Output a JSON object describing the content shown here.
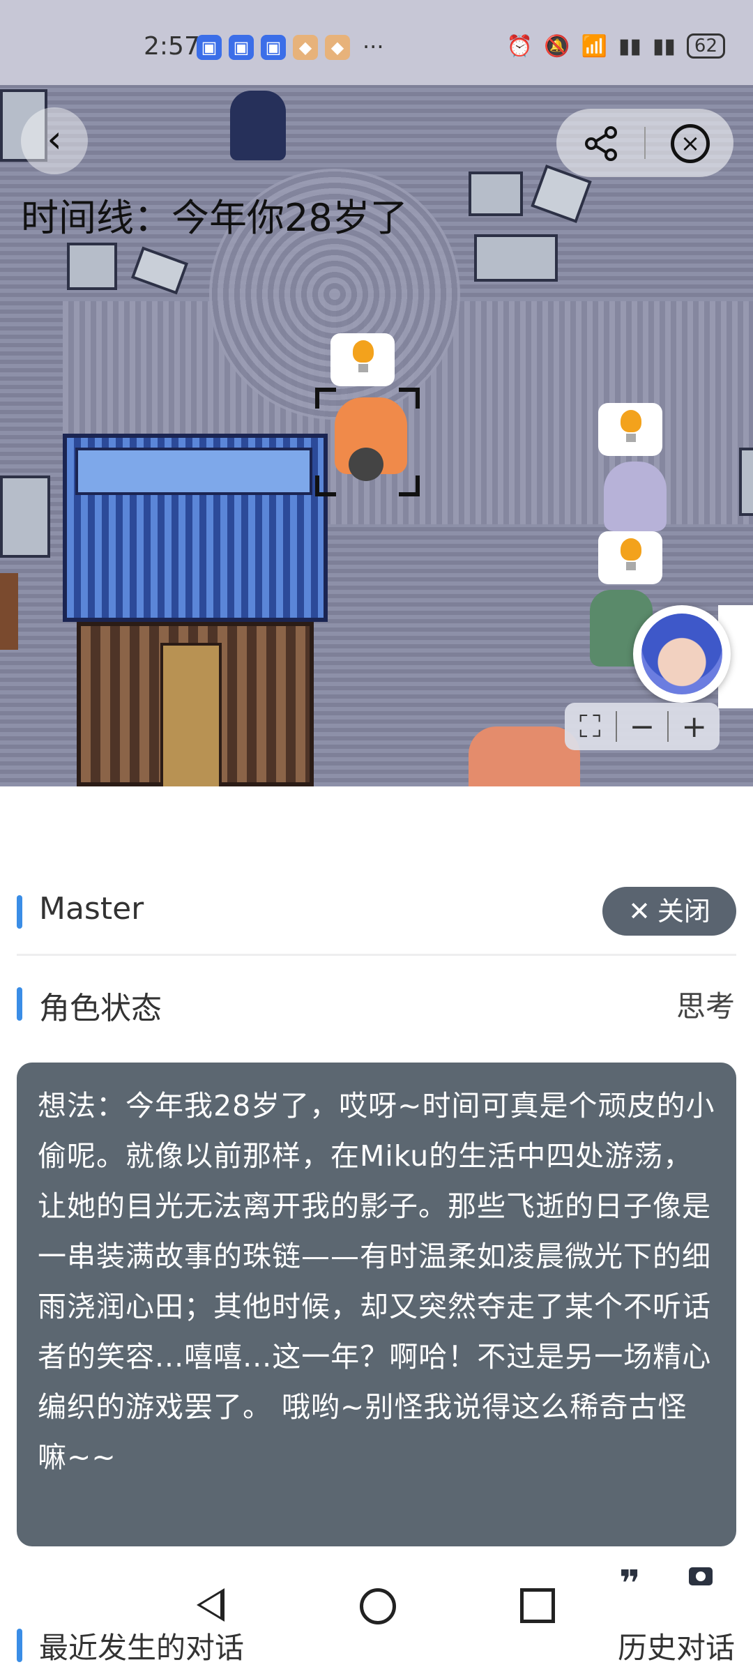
{
  "status_bar": {
    "time": "2:57",
    "more": "···",
    "battery": "62",
    "notification_icons": [
      "calendar-icon",
      "calendar-icon",
      "calendar-icon",
      "app-icon",
      "app-icon"
    ]
  },
  "map": {
    "timeline_label": "时间线：今年你28岁了"
  },
  "zoom": {
    "fit": "⛶",
    "minus": "−",
    "plus": "+"
  },
  "panel": {
    "name": "Master",
    "close_label": "关闭",
    "state_title": "角色状态",
    "state_value": "思考",
    "thought": "想法：今年我28岁了，哎呀~时间可真是个顽皮的小偷呢。就像以前那样，在Miku的生活中四处游荡，让她的目光无法离开我的影子。那些飞逝的日子像是一串装满故事的珠链——有时温柔如凌晨微光下的细雨浇润心田；其他时候，却又突然夺走了某个不听话者的笑容...嘻嘻...这一年？啊哈！不过是另一场精心编织的游戏罢了。 哦哟~别怪我说得这么稀奇古怪嘛~~",
    "recent_title": "最近发生的对话",
    "history_label": "历史对话"
  },
  "colors": {
    "accent": "#3a8de6",
    "pill": "#5a6470",
    "thought_bg": "#5c6771"
  }
}
